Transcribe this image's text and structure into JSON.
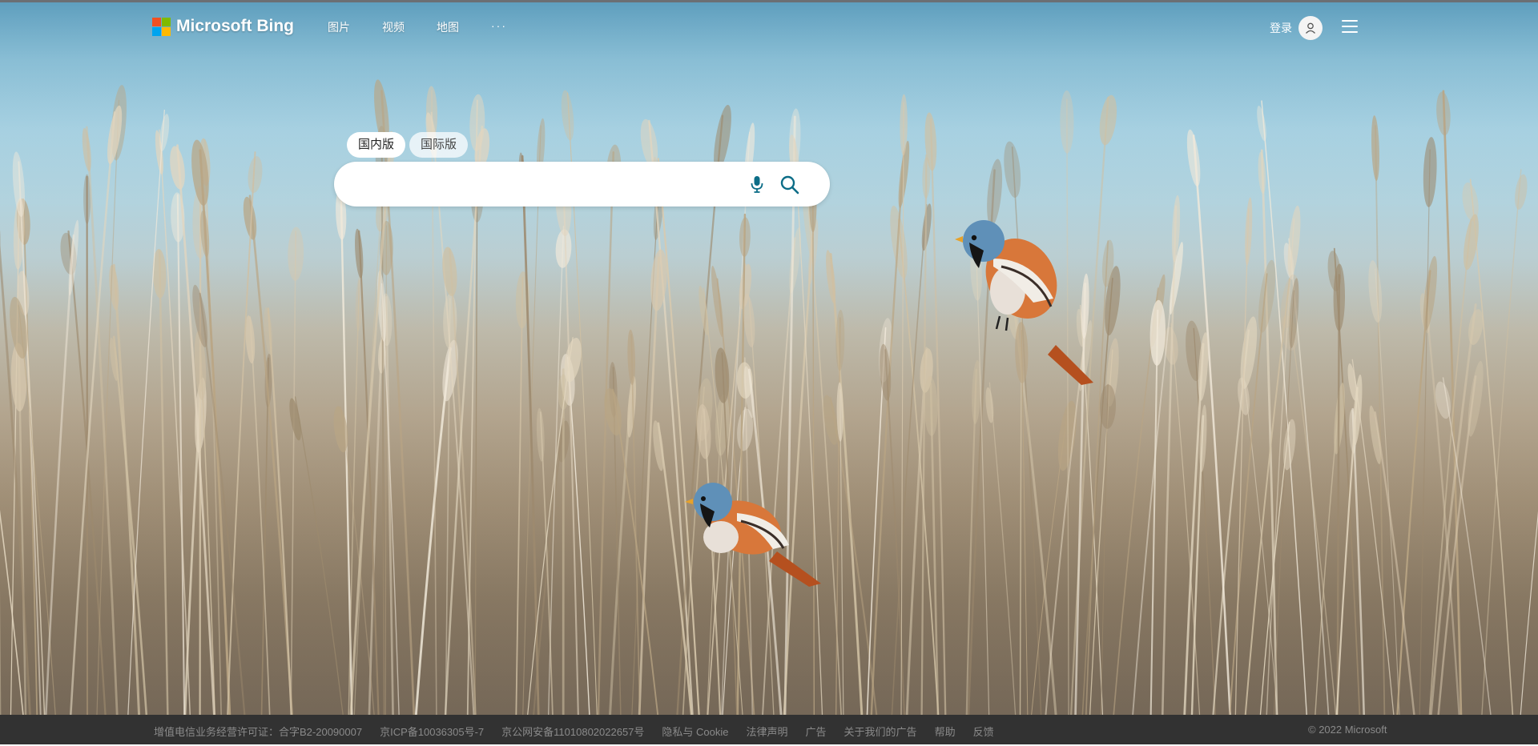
{
  "header": {
    "logo_text": "Microsoft Bing",
    "nav_items": [
      "图片",
      "视频",
      "地图"
    ],
    "nav_more": "···",
    "signin_label": "登录"
  },
  "search": {
    "tabs": [
      {
        "label": "国内版",
        "active": true
      },
      {
        "label": "国际版",
        "active": false
      }
    ],
    "input_value": "",
    "placeholder": ""
  },
  "footer": {
    "links": [
      "增值电信业务经营许可证：合字B2-20090007",
      "京ICP备10036305号-7",
      "京公网安备11010802022657号",
      "隐私与 Cookie",
      "法律声明",
      "广告",
      "关于我们的广告",
      "帮助",
      "反馈"
    ],
    "copyright": "© 2022 Microsoft"
  },
  "colors": {
    "ms_red": "#f25022",
    "ms_green": "#7fba00",
    "ms_blue": "#00a4ef",
    "ms_yellow": "#ffb900",
    "search_icon": "#0c6d87",
    "footer_bg": "#323232",
    "footer_text": "#8a8a8a"
  },
  "icons": [
    "microsoft-logo-icon",
    "user-icon",
    "menu-icon",
    "microphone-icon",
    "search-icon"
  ]
}
